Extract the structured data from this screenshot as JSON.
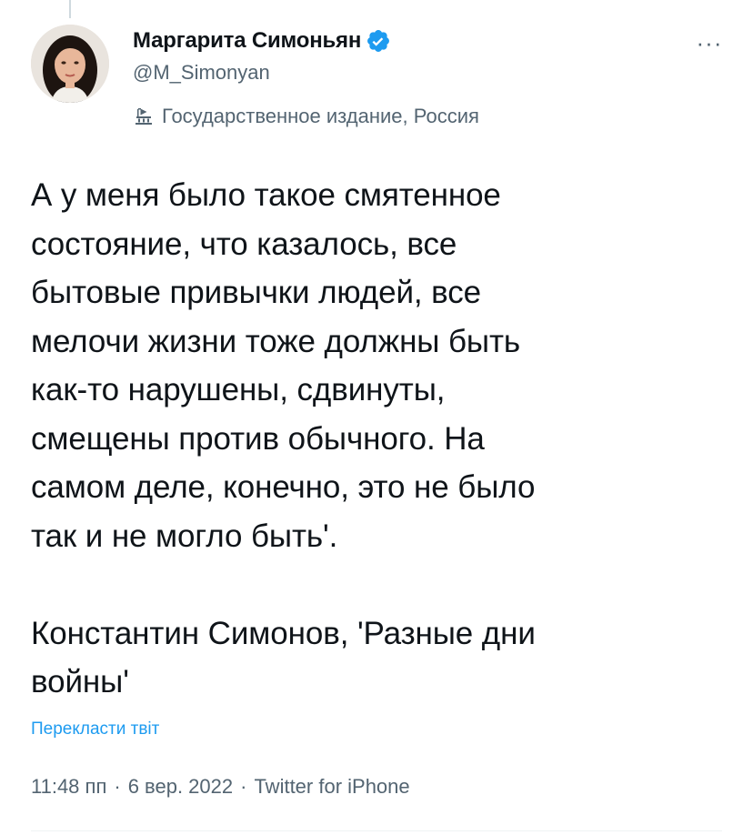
{
  "author": {
    "display_name": "Маргарита Симоньян",
    "handle": "@M_Simonyan",
    "verified": true,
    "verified_color": "#1d9bf0",
    "affiliation_label": "Государственное издание, Россия",
    "affiliation_icon": "government-building-icon"
  },
  "menu": {
    "more_label": "···"
  },
  "tweet": {
    "text": "А у меня было такое смятенное\nсостояние, что казалось, все\nбытовые привычки людей, все\nмелочи жизни тоже должны быть\nкак-то нарушены, сдвинуты,\nсмещены против обычного. На\nсамом деле, конечно, это не было\nтак и не могло быть'.\n\nКонстантин Симонов, 'Разные дни\nвойны'",
    "translate_label": "Перекласти твіт",
    "time": "11:48 пп",
    "separator_1": "·",
    "date": "6 вер. 2022",
    "separator_2": "·",
    "source": "Twitter for iPhone"
  },
  "colors": {
    "text_primary": "#0f1419",
    "text_secondary": "#536471",
    "link": "#1d9bf0",
    "divider": "#eff3f4"
  }
}
